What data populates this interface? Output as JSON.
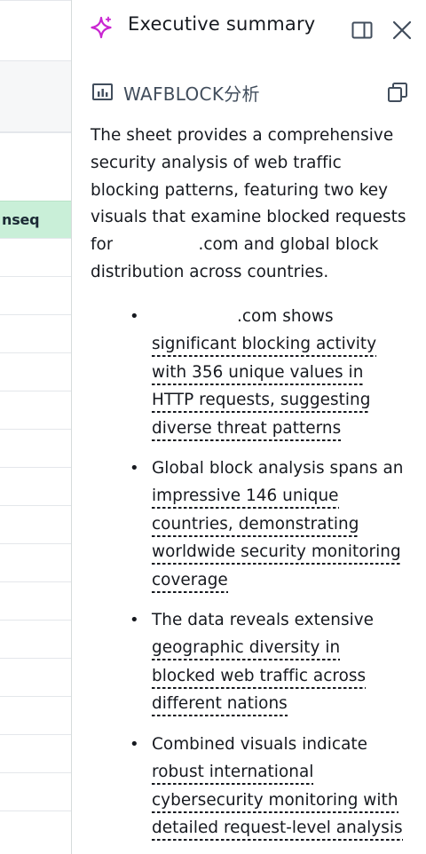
{
  "sheet": {
    "highlight_cell": "nseq"
  },
  "panel": {
    "title": "Executive summary",
    "visual_title": "WAFBLOCK分析",
    "summary_lines": [
      "The sheet provides a comprehensive",
      "security analysis of web traffic",
      "blocking patterns, featuring two key",
      "visuals that examine blocked requests",
      "for",
      ".com and global block",
      "distribution across countries."
    ],
    "bullets": [
      {
        "lines": [
          ".com shows",
          "significant blocking activity",
          "with 356 unique values in",
          "HTTP requests, suggesting",
          "diverse threat patterns"
        ]
      },
      {
        "lines": [
          "Global block analysis spans an",
          "impressive 146 unique",
          "countries, demonstrating",
          "worldwide security monitoring",
          "coverage"
        ]
      },
      {
        "lines": [
          "The data reveals extensive",
          "geographic diversity in",
          "blocked web traffic across",
          "different nations"
        ]
      },
      {
        "lines": [
          "Combined visuals indicate",
          "robust international",
          "cybersecurity monitoring with",
          "detailed request-level analysis"
        ]
      }
    ],
    "bullet_marker": "•",
    "colors": {
      "accent": "#c925d1",
      "text": "#16191f",
      "muted": "#414d5c"
    },
    "icons": [
      "sparkle-icon",
      "split-panel-icon",
      "close-icon",
      "chart-icon",
      "copy-icon"
    ]
  }
}
